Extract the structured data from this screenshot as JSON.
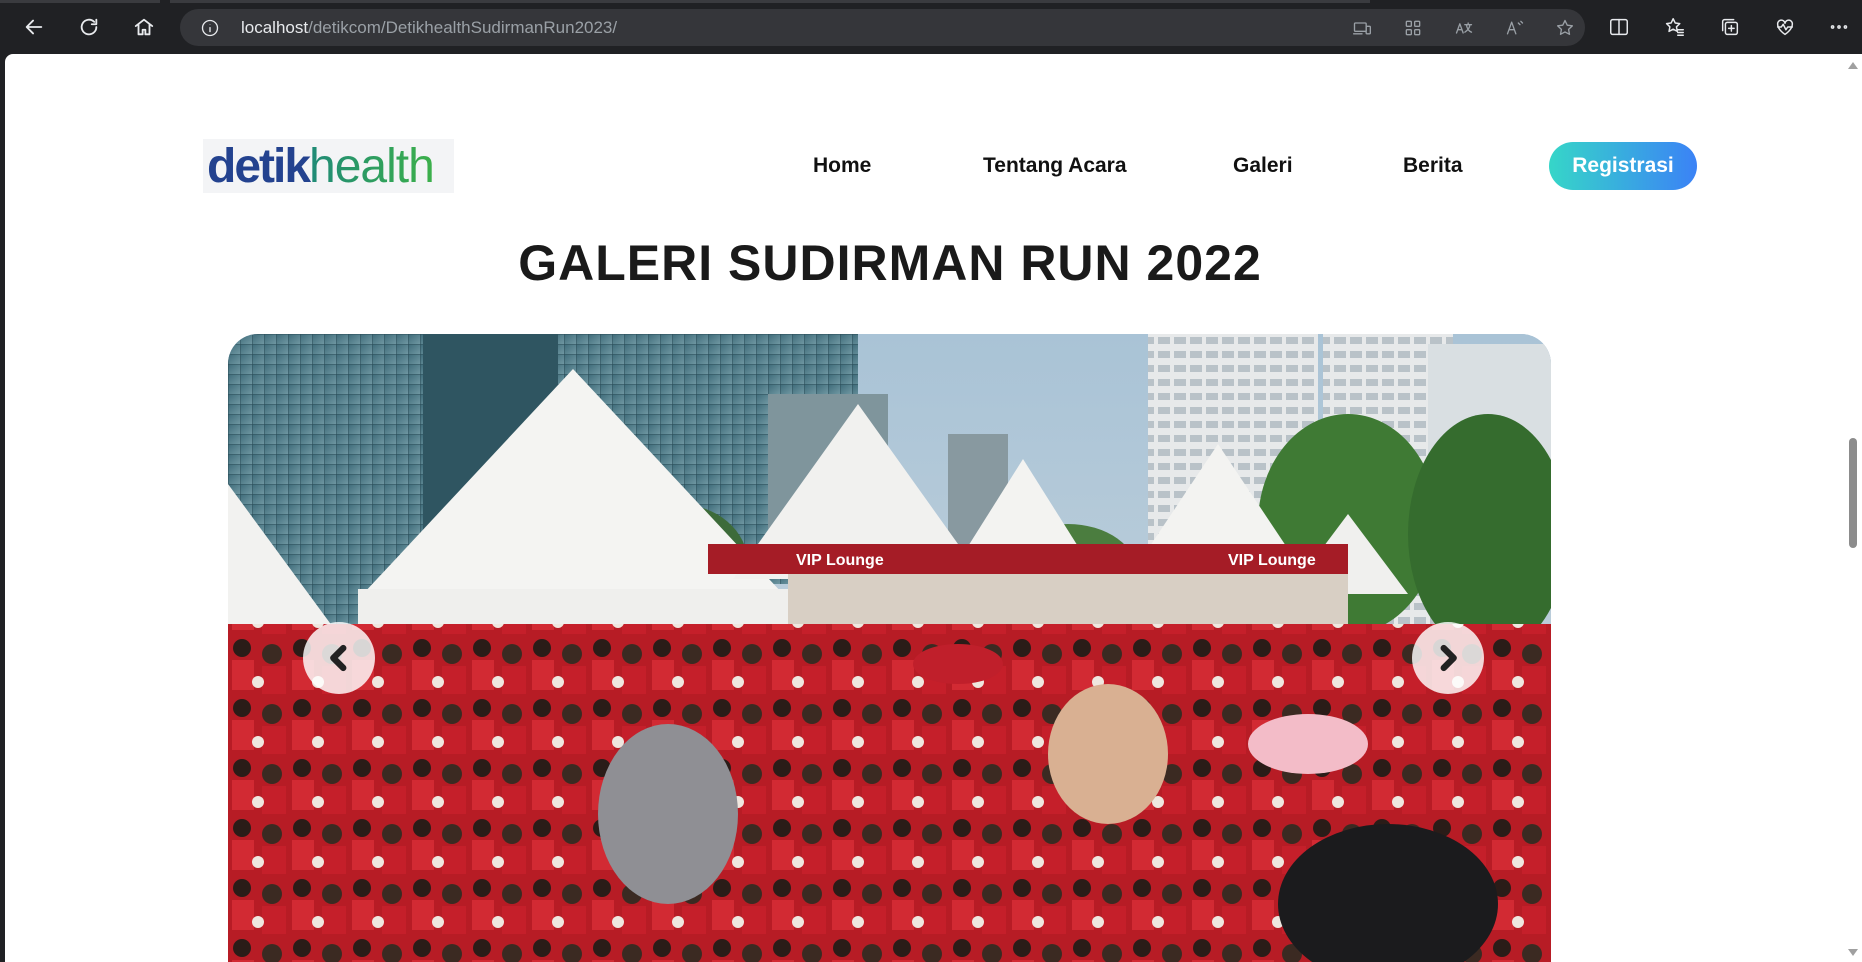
{
  "browser": {
    "url_host": "localhost",
    "url_path": "/detikcom/DetikhealthSudirmanRun2023/",
    "icons": [
      "back-icon",
      "refresh-icon",
      "home-icon",
      "info-icon",
      "device-icon",
      "apps-icon",
      "translate-icon",
      "read-aloud-icon",
      "favorite-star-icon",
      "split-screen-icon",
      "favorites-icon",
      "collections-icon",
      "health-icon",
      "more-icon"
    ]
  },
  "header": {
    "logo_part1": "detik",
    "logo_part2": "health",
    "nav": [
      "Home",
      "Tentang Acara",
      "Galeri",
      "Berita"
    ],
    "cta": "Registrasi"
  },
  "gallery": {
    "title": "GALERI SUDIRMAN RUN 2022",
    "banner_text": "VIP Lounge"
  },
  "colors": {
    "brand_blue": "#23428f",
    "brand_green": "#24a148",
    "cta_gradient_start": "#36d6c8",
    "cta_gradient_end": "#3b82f6",
    "runner_red": "#c3202b"
  }
}
